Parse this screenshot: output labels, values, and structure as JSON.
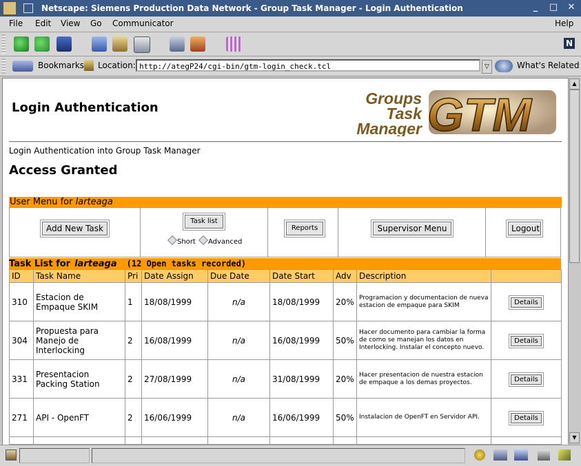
{
  "window": {
    "title": "Netscape: Siemens Production Data Network - Group Task Manager - Login Authentication"
  },
  "menubar": {
    "items": [
      "File",
      "Edit",
      "View",
      "Go",
      "Communicator"
    ],
    "help": "Help"
  },
  "locationbar": {
    "bookmarks_label": "Bookmarks",
    "location_label": "Location:",
    "url": "http://ategP24/cgi-bin/gtm-login_check.tcl",
    "whats_related": "What's Related"
  },
  "page": {
    "title": "Login Authentication",
    "logo_text": [
      "Groups",
      "Task",
      "Manager"
    ],
    "logo_mark": "GTM",
    "subtitle": "Login Authentication into Group Task Manager",
    "status_heading": "Access Granted"
  },
  "user_menu": {
    "label": "User Menu for ",
    "user": "larteaga",
    "buttons": {
      "add_task": "Add New Task",
      "task_list": "Task list",
      "reports": "Reports",
      "supervisor": "Supervisor Menu",
      "logout": "Logout"
    },
    "radio_short": "Short",
    "radio_advanced": "Advanced"
  },
  "task_list": {
    "label": "Task List for",
    "user": "larteaga",
    "count": "(12 Open tasks recorded)",
    "columns": [
      "ID",
      "Task Name",
      "Pri",
      "Date Assign",
      "Due Date",
      "Date Start",
      "Adv",
      "Description",
      ""
    ],
    "details_label": "Details",
    "rows": [
      {
        "id": "310",
        "name": "Estacion de Empaque SKIM",
        "pri": "1",
        "assign": "18/08/1999",
        "due": "n/a",
        "start": "18/08/1999",
        "adv": "20%",
        "desc": "Programacion y documentacion de nueva estacion de empaque para SKIM"
      },
      {
        "id": "304",
        "name": "Propuesta para Manejo de Interlocking",
        "pri": "2",
        "assign": "16/08/1999",
        "due": "n/a",
        "start": "16/08/1999",
        "adv": "50%",
        "desc": "Hacer documento para cambiar la forma de como se manejan los datos en Interlocking. Instalar el concepto nuevo."
      },
      {
        "id": "331",
        "name": "Presentacion Packing Station",
        "pri": "2",
        "assign": "27/08/1999",
        "due": "n/a",
        "start": "31/08/1999",
        "adv": "20%",
        "desc": "Hacer presentacion de nuestra estacion de empaque a los demas proyectos."
      },
      {
        "id": "271",
        "name": "API - OpenFT",
        "pri": "2",
        "assign": "16/06/1999",
        "due": "n/a",
        "start": "16/06/1999",
        "adv": "50%",
        "desc": "Instalacion de OpenFT en Servidor API."
      }
    ]
  },
  "colors": {
    "orange_bar": "#ff9900",
    "header_row": "#ffcc66",
    "titlebar": "#3a5a8a"
  }
}
